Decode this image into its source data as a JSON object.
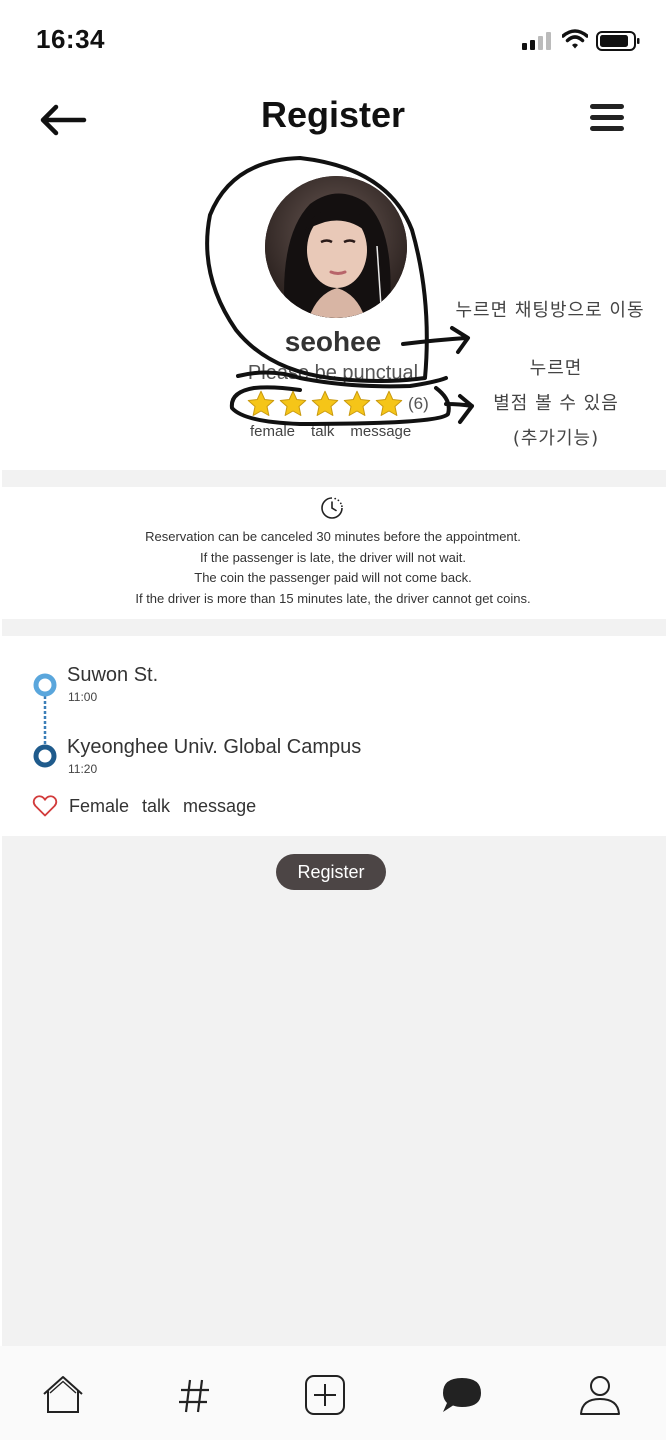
{
  "status_bar": {
    "time": "16:34"
  },
  "header": {
    "title": "Register",
    "back_icon": "arrow-left-icon",
    "menu_icon": "hamburger-menu-icon"
  },
  "profile": {
    "name": "seohee",
    "bio": "Please be punctual",
    "rating": 5,
    "rating_max": 5,
    "rating_count": "(6)",
    "tags": [
      "female",
      "talk",
      "message"
    ]
  },
  "annotations": {
    "avatar_note": "누르면 채팅방으로 이동",
    "rating_note_1": "누르면",
    "rating_note_2": "별점 볼 수 있음",
    "rating_note_3": "(추가기능)"
  },
  "policy": {
    "icon": "clock-icon",
    "lines": [
      "Reservation can be canceled 30 minutes before the appointment.",
      "If the passenger is late, the driver will not wait.",
      "The coin the passenger paid will not come back.",
      "If the driver is more than 15 minutes late, the driver cannot get coins."
    ]
  },
  "route": {
    "stops": [
      {
        "name": "Suwon St.",
        "time": "11:00"
      },
      {
        "name": "Kyeonghee Univ. Global Campus",
        "time": "11:20"
      }
    ],
    "tags": [
      "Female",
      "talk",
      "message"
    ]
  },
  "actions": {
    "register_label": "Register"
  },
  "tab_bar": {
    "items": [
      {
        "name": "home",
        "icon": "home-icon"
      },
      {
        "name": "hashtag",
        "icon": "hashtag-icon"
      },
      {
        "name": "add",
        "icon": "plus-square-icon"
      },
      {
        "name": "chat",
        "icon": "chat-bubble-icon"
      },
      {
        "name": "profile",
        "icon": "user-icon"
      }
    ]
  },
  "colors": {
    "accent_light_blue": "#5aa6dc",
    "accent_dark_blue": "#1f5b8c",
    "button_dark": "#4c4545",
    "star_yellow": "#f5c518",
    "heart_red": "#d23b3b"
  }
}
